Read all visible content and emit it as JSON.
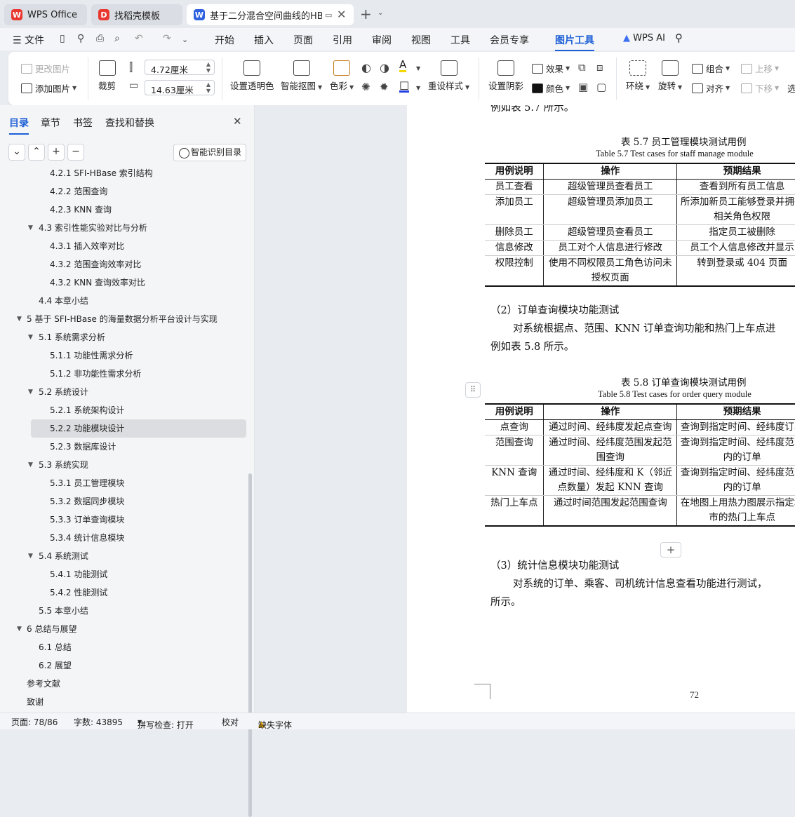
{
  "tabs": [
    {
      "label": "WPS Office"
    },
    {
      "label": "找稻壳模板"
    },
    {
      "label": "基于二分混合空间曲线的HBa"
    }
  ],
  "menu": {
    "file": "文件",
    "items": [
      "开始",
      "插入",
      "页面",
      "引用",
      "审阅",
      "视图",
      "工具",
      "会员专享",
      "图片工具"
    ],
    "ai": "WPS AI"
  },
  "ribbon": {
    "change_image": "更改图片",
    "add_image": "添加图片",
    "crop": "裁剪",
    "width": "4.72厘米",
    "height": "14.63厘米",
    "transparent": "设置透明色",
    "smart_cutout": "智能抠图",
    "color_mode": "色彩",
    "reset_style": "重设样式",
    "shadow": "设置阴影",
    "effect": "效果",
    "color": "颜色",
    "wrap": "环绕",
    "rotate": "旋转",
    "group": "组合",
    "align": "对齐",
    "up": "上移",
    "down": "下移",
    "more": "选"
  },
  "sidebar": {
    "tabs": [
      "目录",
      "章节",
      "书签",
      "查找和替换"
    ],
    "ai_toc": "智能识别目录",
    "toc": [
      {
        "label": "4.2.1 SFI-HBase 索引结构",
        "level": 3
      },
      {
        "label": "4.2.2  范围查询",
        "level": 3
      },
      {
        "label": "4.2.3 KNN 查询",
        "level": 3
      },
      {
        "label": "4.3 索引性能实验对比与分析",
        "level": 2,
        "open": true
      },
      {
        "label": "4.3.1  插入效率对比",
        "level": 3
      },
      {
        "label": "4.3.2  范围查询效率对比",
        "level": 3
      },
      {
        "label": "4.3.2 KNN 查询效率对比",
        "level": 3
      },
      {
        "label": "4.4  本章小结",
        "level": 2
      },
      {
        "label": "5  基于 SFI-HBase 的海量数据分析平台设计与实现",
        "level": 1,
        "open": true
      },
      {
        "label": "5.1  系统需求分析",
        "level": 2,
        "open": true
      },
      {
        "label": "5.1.1  功能性需求分析",
        "level": 3
      },
      {
        "label": "5.1.2  非功能性需求分析",
        "level": 3
      },
      {
        "label": "5.2  系统设计",
        "level": 2,
        "open": true
      },
      {
        "label": "5.2.1  系统架构设计",
        "level": 3
      },
      {
        "label": "5.2.2  功能模块设计",
        "level": 3,
        "selected": true
      },
      {
        "label": "5.2.3  数据库设计",
        "level": 3
      },
      {
        "label": "5.3 系统实现",
        "level": 2,
        "open": true
      },
      {
        "label": "5.3.1  员工管理模块",
        "level": 3
      },
      {
        "label": "5.3.2  数据同步模块",
        "level": 3
      },
      {
        "label": "5.3.3  订单查询模块",
        "level": 3
      },
      {
        "label": "5.3.4  统计信息模块",
        "level": 3
      },
      {
        "label": "5.4  系统测试",
        "level": 2,
        "open": true
      },
      {
        "label": "5.4.1  功能测试",
        "level": 3
      },
      {
        "label": "5.4.2  性能测试",
        "level": 3
      },
      {
        "label": "5.5  本章小结",
        "level": 2
      },
      {
        "label": "6  总结与展望",
        "level": 1,
        "open": true
      },
      {
        "label": "6.1  总结",
        "level": 2
      },
      {
        "label": "6.2  展望",
        "level": 2
      },
      {
        "label": "参考文献",
        "level": 1
      },
      {
        "label": "致谢",
        "level": 1
      }
    ]
  },
  "doc": {
    "top_line": "例如表 5.7 所示。",
    "t1_cap": "表 5.7  员工管理模块测试用例",
    "t1_cap_en": "Table 5.7 Test cases for staff manage module",
    "headers": [
      "用例说明",
      "操作",
      "预期结果"
    ],
    "t1_rows": [
      [
        "员工查看",
        "超级管理员查看员工",
        "查看到所有员工信息"
      ],
      [
        "添加员工",
        "超级管理员添加员工",
        "所添加新员工能够登录并拥有相关角色权限"
      ],
      [
        "删除员工",
        "超级管理员查看员工",
        "指定员工被删除"
      ],
      [
        "信息修改",
        "员工对个人信息进行修改",
        "员工个人信息修改并显示"
      ],
      [
        "权限控制",
        "使用不同权限员工角色访问未授权页面",
        "转到登录或 404 页面"
      ]
    ],
    "sec2": "（2）订单查询模块功能测试",
    "sec2_p1": "对系统根据点、范围、KNN 订单查询功能和热门上车点进",
    "sec2_p2": "例如表 5.8 所示。",
    "t2_cap": "表 5.8  订单查询模块测试用例",
    "t2_cap_en": "Table 5.8 Test cases for order query module",
    "t2_rows": [
      [
        "点查询",
        "通过时间、经纬度发起点查询",
        "查询到指定时间、经纬度订单"
      ],
      [
        "范围查询",
        "通过时间、经纬度范围发起范围查询",
        "查询到指定时间、经纬度范围内的订单"
      ],
      [
        "KNN 查询",
        "通过时间、经纬度和 K（邻近点数量）发起 KNN 查询",
        "查询到指定时间、经纬度范围内的订单"
      ],
      [
        "热门上车点",
        "通过时间范围发起范围查询",
        "在地图上用热力图展示指定城市的热门上车点"
      ]
    ],
    "sec3": "（3）统计信息模块功能测试",
    "sec3_p1": "对系统的订单、乘客、司机统计信息查看功能进行测试，",
    "sec3_p2": "所示。",
    "page_number": "72"
  },
  "status": {
    "page": "页面: 78/86",
    "words": "字数: 43895",
    "spell": "拼写检查: 打开",
    "proof": "校对",
    "font": "缺失字体"
  }
}
